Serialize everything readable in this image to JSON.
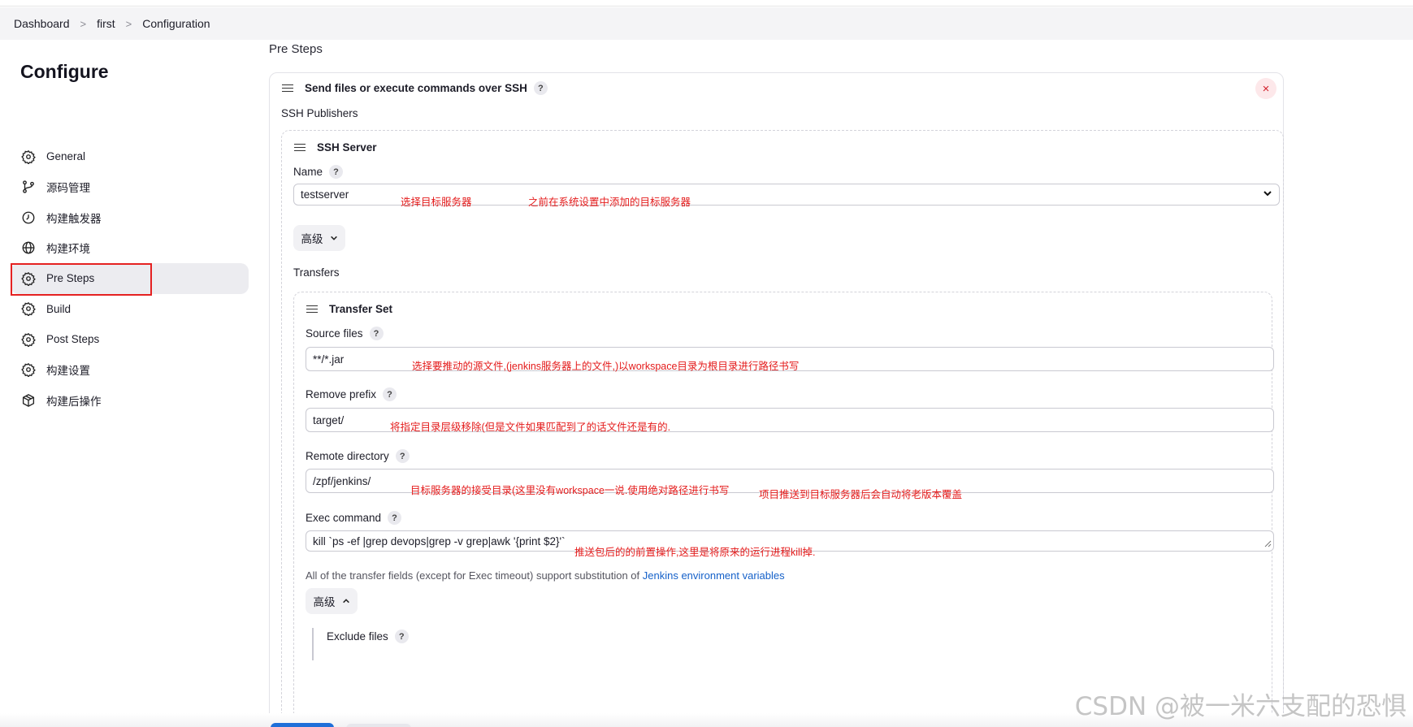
{
  "breadcrumb": {
    "items": [
      "Dashboard",
      "first",
      "Configuration"
    ]
  },
  "sidebar": {
    "title": "Configure",
    "items": [
      {
        "label": "General",
        "icon": "gear-icon"
      },
      {
        "label": "源码管理",
        "icon": "branch-icon"
      },
      {
        "label": "构建触发器",
        "icon": "clock-icon"
      },
      {
        "label": "构建环境",
        "icon": "globe-icon"
      },
      {
        "label": "Pre Steps",
        "icon": "gear-icon",
        "active": true
      },
      {
        "label": "Build",
        "icon": "gear-icon"
      },
      {
        "label": "Post Steps",
        "icon": "gear-icon"
      },
      {
        "label": "构建设置",
        "icon": "gear-icon"
      },
      {
        "label": "构建后操作",
        "icon": "package-icon"
      }
    ]
  },
  "main": {
    "section_title": "Pre Steps",
    "ssh_card": {
      "title": "Send files or execute commands over SSH",
      "publishers_label": "SSH Publishers",
      "close_symbol": "×"
    },
    "server": {
      "title": "SSH Server",
      "name_label": "Name",
      "name_value": "testserver",
      "note1": "选择目标服务器",
      "note2": "之前在系统设置中添加的目标服务器",
      "advanced_label": "高级",
      "transfers_label": "Transfers"
    },
    "transfer": {
      "title": "Transfer Set",
      "source_label": "Source files",
      "source_value": "**/*.jar",
      "source_note": "选择要推动的源文件,(jenkins服务器上的文件,)以workspace目录为根目录进行路径书写",
      "prefix_label": "Remove prefix",
      "prefix_value": "target/",
      "prefix_note": "将指定目录层级移除(但是文件如果匹配到了的话文件还是有的.",
      "remote_label": "Remote directory",
      "remote_value": "/zpf/jenkins/",
      "remote_note1": "目标服务器的接受目录(这里没有workspace一说.使用绝对路径进行书写",
      "remote_note2": "项目推送到目标服务器后会自动将老版本覆盖",
      "exec_label": "Exec command",
      "exec_value": "kill `ps -ef |grep devops|grep -v grep|awk '{print $2}'`",
      "exec_note": "推送包后的的前置操作,这里是将原来的运行进程kill掉.",
      "hint_text": "All of the transfer fields (except for Exec timeout) support substitution of ",
      "hint_link": "Jenkins environment variables",
      "advanced_label": "高级",
      "exclude_label": "Exclude files"
    },
    "help_symbol": "?"
  },
  "watermark": "CSDN @被一米六支配的恐惧",
  "colors": {
    "note_red": "#e41b1b",
    "link_blue": "#1561c9",
    "primary": "#1f6fd9"
  }
}
